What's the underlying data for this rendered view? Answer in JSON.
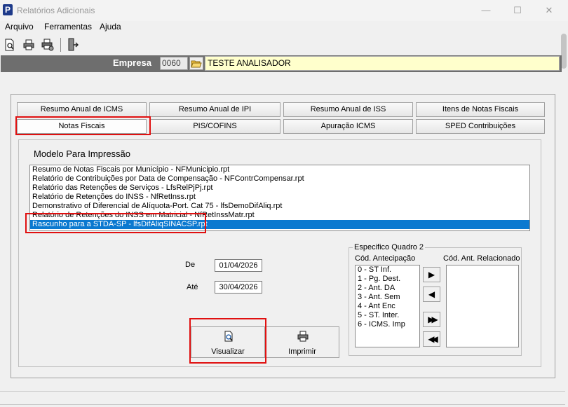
{
  "window": {
    "title": "Relatórios Adicionais",
    "minimize": "—",
    "maximize": "☐",
    "close": "✕"
  },
  "menu": [
    "Arquivo",
    "Ferramentas",
    "Ajuda"
  ],
  "empresa": {
    "label": "Empresa",
    "code": "0060",
    "name": "TESTE ANALISADOR"
  },
  "tabs": [
    "Resumo Anual de ICMS",
    "Resumo Anual de IPI",
    "Resumo Anual de ISS",
    "Itens de Notas Fiscais",
    "Notas Fiscais",
    "PIS/COFINS",
    "Apuração ICMS",
    "SPED Contribuições"
  ],
  "modelo": {
    "title": "Modelo Para Impressão",
    "items": [
      "Resumo de Notas Fiscais por Município - NFMunicipio.rpt",
      "Relatório de Contribuições por Data de Compensação - NFContrCompensar.rpt",
      "Relatório das Retenções de Serviços - LfsRelPjPj.rpt",
      "Relatório de Retenções do INSS - NfRetInss.rpt",
      "Demonstrativo of Diferencial de Alíquota-Port. Cat 75 - lfsDemoDifAliq.rpt",
      "Relatório de Retenções do INSS em Matricial - NfRetInssMatr.rpt",
      "Rascunho para a STDA-SP - lfsDifAliqSINACSP.rpt"
    ]
  },
  "periodo": {
    "de_label": "De",
    "de_value": "01/04/2026",
    "ate_label": "Até",
    "ate_value": "30/04/2026"
  },
  "buttons": {
    "visualizar": "Visualizar",
    "imprimir": "Imprimir"
  },
  "quadro": {
    "title": "Especifico Quadro 2",
    "cod_antecipacao_label": "Cód. Antecipação",
    "cod_ant_relacionado_label": "Cód. Ant. Relacionado",
    "antecipacao_items": [
      "0 - ST Inf.",
      "1 - Pg. Dest.",
      "2 - Ant. DA",
      "3 - Ant. Sem",
      "4 - Ant Enc",
      "5 - ST. Inter.",
      "6 - ICMS. Imp"
    ]
  },
  "colors": {
    "selection": "#0b79d0",
    "empresa_bar": "#6e6e6e",
    "empresa_name_bg": "#ffffcc",
    "highlight": "#e01010"
  }
}
